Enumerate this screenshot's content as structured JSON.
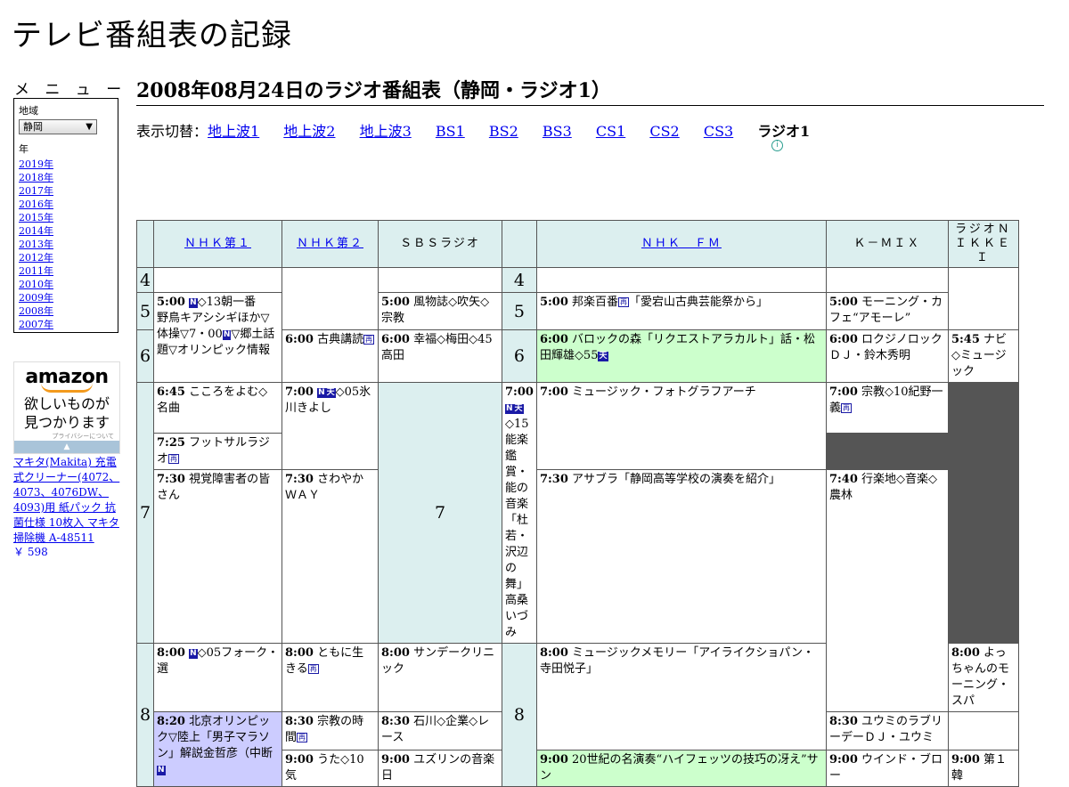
{
  "site": {
    "title": "テレビ番組表の記録"
  },
  "menu": {
    "label": "メ ニ ュ ー",
    "region_label": "地域",
    "region_value": "静岡",
    "year_label": "年",
    "years": [
      "2019年",
      "2018年",
      "2017年",
      "2016年",
      "2015年",
      "2014年",
      "2013年",
      "2012年",
      "2011年",
      "2010年",
      "2009年",
      "2008年",
      "2007年"
    ]
  },
  "ad": {
    "logo": "amazon",
    "tagline_1": "欲しいものが",
    "tagline_2": "見つかります",
    "privacy": "プライバシーについて",
    "product_title": "マキタ(Makita) 充電式クリーナー(4072、4073、4076DW、4093)用 紙パック 抗菌仕様 10枚入 マキタ 掃除機 A-48511",
    "product_price": "￥ 598"
  },
  "page": {
    "heading": "2008年08月24日のラジオ番組表（静岡・ラジオ1）",
    "switch_label": "表示切替：",
    "switch_links": [
      "地上波1",
      "地上波2",
      "地上波3",
      "BS1",
      "BS2",
      "BS3",
      "CS1",
      "CS2",
      "CS3"
    ],
    "switch_current": "ラジオ1",
    "info_icon": "info-icon"
  },
  "schedule": {
    "channels": [
      "ＮＨＫ第１",
      "ＮＨＫ第２",
      "ＳＢＳラジオ",
      "ＮＨＫ　ＦＭ",
      "Ｋ－ＭＩＸ",
      "ラジオＮＩＫＫＥＩ"
    ],
    "hours": [
      "4",
      "5",
      "6",
      "7",
      "8"
    ],
    "tags": {
      "news": "N",
      "weather": "天",
      "rebroadcast": "再"
    },
    "programs": {
      "nhk1_0500": {
        "time": "5:00",
        "a": "◇13朝一番　野鳥キアシシギほか▽体操▽7・00",
        "b": "▽郷土話題▽オリンピック情報"
      },
      "nhk1_0800": {
        "time": "8:00",
        "a": "◇05フォーク・選"
      },
      "nhk1_0820": {
        "time": "8:20",
        "a": "北京オリンピック▽陸上「男子マラソン」解説金哲彦（中断"
      },
      "nhk2_0600": {
        "time": "6:00",
        "a": "古典講読"
      },
      "nhk2_0645": {
        "time": "6:45",
        "a": "こころをよむ◇名曲"
      },
      "nhk2_0730": {
        "time": "7:30",
        "a": "視覚障害者の皆さん"
      },
      "nhk2_0800": {
        "time": "8:00",
        "a": "ともに生きる"
      },
      "nhk2_0830": {
        "time": "8:30",
        "a": "宗教の時間"
      },
      "nhk2_0900": {
        "time": "9:00",
        "a": "うた◇10気"
      },
      "sbs_0500": {
        "time": "5:00",
        "a": "風物誌◇吹矢◇宗教"
      },
      "sbs_0600": {
        "time": "6:00",
        "a": "幸福◇梅田◇45高田"
      },
      "sbs_0700": {
        "time": "7:00",
        "a": "◇05氷川きよし"
      },
      "sbs_0730": {
        "time": "7:30",
        "a": "さわやかＷＡＹ"
      },
      "sbs_0800": {
        "time": "8:00",
        "a": "サンデークリニック"
      },
      "sbs_0830": {
        "time": "8:30",
        "a": "石川◇企業◇レース"
      },
      "sbs_0900": {
        "time": "9:00",
        "a": "ユズリンの音楽日"
      },
      "fm_0500": {
        "time": "5:00",
        "a": "邦楽百番",
        "b": "「愛宕山古典芸能祭から」"
      },
      "fm_0600": {
        "time": "6:00",
        "a": "バロックの森「リクエストアラカルト」話・松田輝雄◇55"
      },
      "fm_0700": {
        "time": "7:00",
        "a": "◇15能楽鑑賞・能の音楽「杜若・沢辺の舞」高桑いづみ"
      },
      "fm_0800": {
        "time": "8:00",
        "a": "ミュージックメモリー「アイライクショパン・寺田悦子」"
      },
      "fm_0900": {
        "time": "9:00",
        "a": "20世紀の名演奏“ハイフェッツの技巧の冴え”サン"
      },
      "kmix_0500": {
        "time": "5:00",
        "a": "モーニング・カフェ“アモーレ”"
      },
      "kmix_0600": {
        "time": "6:00",
        "a": "ロクジノロックＤＪ・鈴木秀明"
      },
      "kmix_0700": {
        "time": "7:00",
        "a": "ミュージック・フォトグラフアーチ"
      },
      "kmix_0730": {
        "time": "7:30",
        "a": "アサブラ「静岡高等学校の演奏を紹介」"
      },
      "kmix_0800": {
        "time": "8:00",
        "a": "よっちゃんのモーニング・スパ"
      },
      "kmix_0830": {
        "time": "8:30",
        "a": "ユウミのラブリーデーＤＪ・ユウミ"
      },
      "kmix_0900": {
        "time": "9:00",
        "a": "ウインド・ブロー"
      },
      "nikkei_0545": {
        "time": "5:45",
        "a": "ナビ◇ミュージック"
      },
      "nikkei_0700": {
        "time": "7:00",
        "a": "宗教◇10紀野一義"
      },
      "nikkei_0725": {
        "time": "7:25",
        "a": "フットサルラジオ"
      },
      "nikkei_0740": {
        "time": "7:40",
        "a": "行楽地◇音楽◇農林"
      },
      "nikkei_0900": {
        "time": "9:00",
        "a": "第１韓"
      }
    }
  }
}
